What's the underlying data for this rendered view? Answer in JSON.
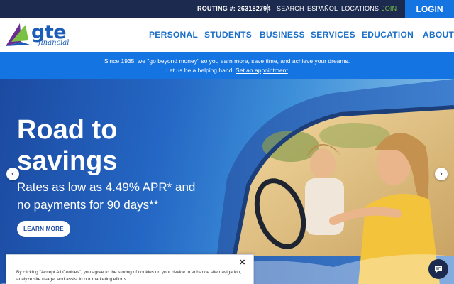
{
  "utility": {
    "routing": "ROUTING #: 263182794",
    "search": "SEARCH",
    "espanol": "ESPAÑOL",
    "locations": "LOCATIONS",
    "join": "JOIN",
    "login": "LOGIN"
  },
  "logo": {
    "word": "gte",
    "sub": "financial"
  },
  "nav": {
    "personal": "PERSONAL",
    "students": "STUDENTS",
    "business": "BUSINESS",
    "services": "SERVICES",
    "education": "EDUCATION",
    "about": "ABOUT"
  },
  "announcement": {
    "line1": "Since 1935, we \"go beyond money\" so you earn more, save time, and achieve your dreams.",
    "line2_prefix": "Let us be a helping hand!",
    "link": "Set an appointment"
  },
  "hero": {
    "title_line1": "Road to",
    "title_line2": "savings",
    "sub_line1": "Rates as low as 4.49% APR* and",
    "sub_line2": "no payments for 90 days**",
    "cta": "LEARN MORE",
    "prev_icon": "‹",
    "next_icon": "›"
  },
  "cookie": {
    "text": "By clicking \"Accept All Cookies\", you agree to the storing of cookies on your device to enhance site navigation, analyze site usage, and assist in our marketing efforts.",
    "close": "✕"
  },
  "colors": {
    "utility_bg": "#1c2a4f",
    "accent_blue": "#1474e2",
    "join_green": "#7ac143",
    "nav_blue": "#1a6fc9"
  }
}
